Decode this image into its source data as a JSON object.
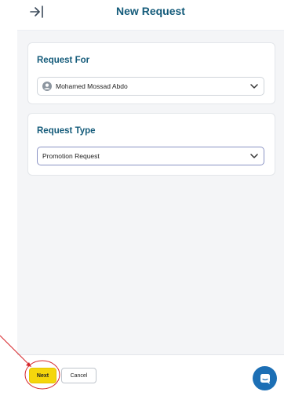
{
  "header": {
    "title": "New Request",
    "collapse_icon": "collapse-right-icon"
  },
  "request_for": {
    "title": "Request For",
    "selected_value": "Mohamed Mossad Abdo",
    "icon": "user-avatar-icon"
  },
  "request_type": {
    "title": "Request Type",
    "selected_value": "Promotion Request"
  },
  "footer": {
    "next_label": "Next",
    "cancel_label": "Cancel",
    "chat_icon": "chat-icon"
  },
  "colors": {
    "accent_title": "#145b7a",
    "next_button": "#f5d60c",
    "chat_button": "#1c6fb5",
    "annotation": "#d6262b"
  }
}
